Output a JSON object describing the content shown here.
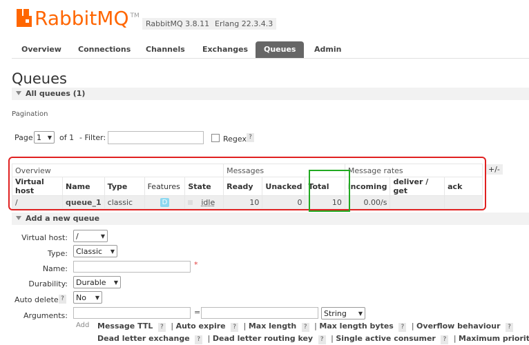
{
  "brand": {
    "name": "RabbitMQ",
    "tm": "TM",
    "version": "RabbitMQ 3.8.11",
    "erlang": "Erlang 22.3.4.3"
  },
  "tabs": [
    "Overview",
    "Connections",
    "Channels",
    "Exchanges",
    "Queues",
    "Admin"
  ],
  "page_title": "Queues",
  "all_queues": "All queues (1)",
  "pagination": {
    "label": "Pagination",
    "page_label": "Page",
    "page_value": "1",
    "of": "of 1",
    "filter_label": "- Filter:",
    "regex_label": "Regex",
    "help": "?"
  },
  "table": {
    "groups": [
      "Overview",
      "Messages",
      "Message rates"
    ],
    "plusminus": "+/-",
    "headers": [
      "Virtual host",
      "Name",
      "Type",
      "Features",
      "State",
      "Ready",
      "Unacked",
      "Total",
      "incoming",
      "deliver / get",
      "ack"
    ],
    "row": {
      "vhost": "/",
      "name": "queue_1",
      "type": "classic",
      "feature": "D",
      "state": "idle",
      "ready": "10",
      "unacked": "0",
      "total": "10",
      "incoming": "0.00/s",
      "deliver": "",
      "ack": ""
    }
  },
  "add_queue": {
    "title": "Add a new queue",
    "vhost_label": "Virtual host:",
    "vhost_value": "/",
    "type_label": "Type:",
    "type_value": "Classic",
    "name_label": "Name:",
    "required": "*",
    "durability_label": "Durability:",
    "durability_value": "Durable",
    "autodelete_label": "Auto delete:",
    "autodelete_value": "No",
    "arguments_label": "Arguments:",
    "equals": "=",
    "arg_type": "String",
    "add": "Add",
    "args_row1": [
      "Message TTL",
      "Auto expire",
      "Max length",
      "Max length bytes",
      "Overflow behaviour"
    ],
    "args_row2": [
      "Dead letter exchange",
      "Dead letter routing key",
      "Single active consumer",
      "Maximum priority"
    ]
  },
  "colors": {
    "brand": "#ff6600",
    "highlight_red": "#e02020",
    "highlight_green": "#22aa22"
  }
}
